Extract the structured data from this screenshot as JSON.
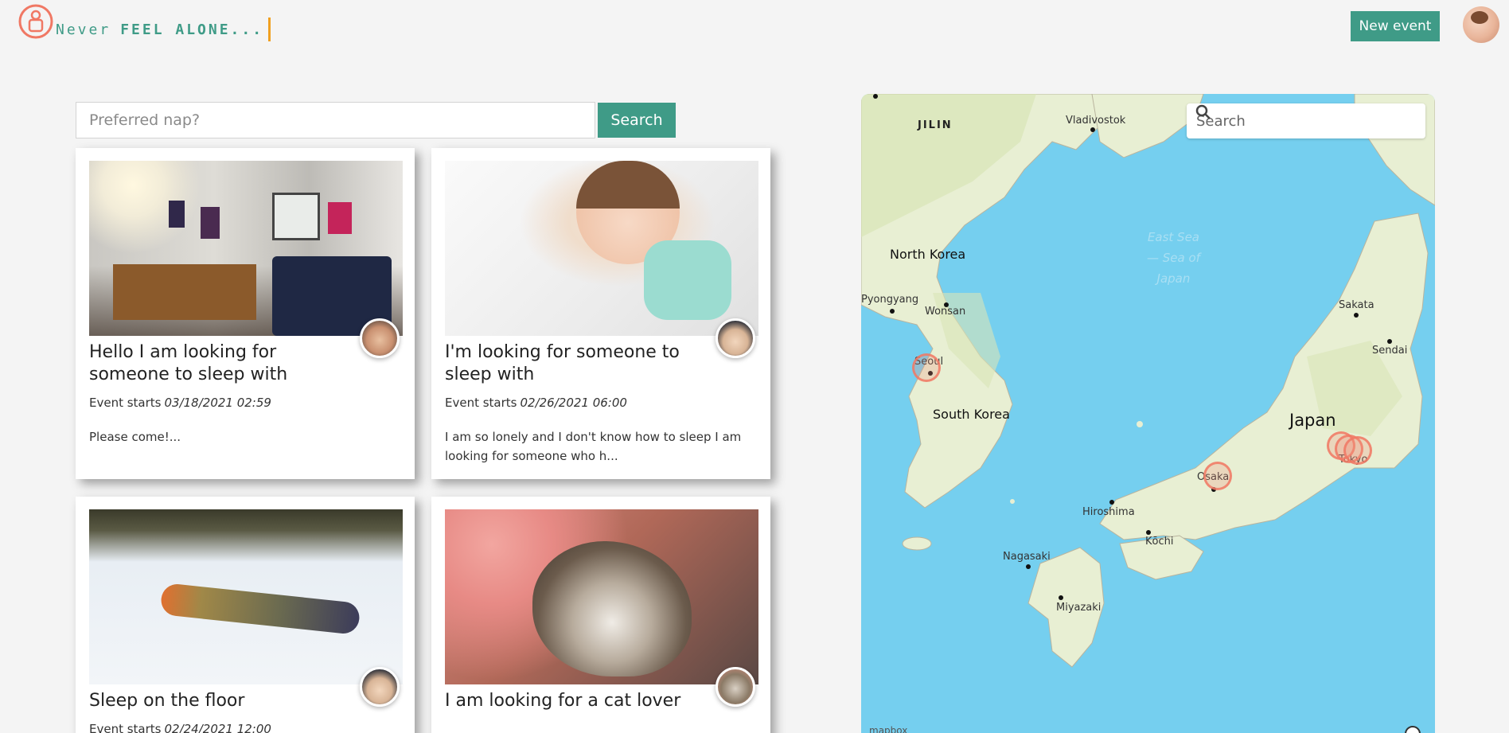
{
  "header": {
    "tagline_prefix": "Never",
    "tagline_strong": "FEEL ALONE...",
    "new_event_label": "New event"
  },
  "search": {
    "placeholder": "Preferred nap?",
    "button_label": "Search"
  },
  "cards": [
    {
      "title": "Hello I am looking for someone to sleep with",
      "starts_label": "Event starts",
      "starts_date": "03/18/2021 02:59",
      "description": "Please come!..."
    },
    {
      "title": "I'm looking for someone to sleep with",
      "starts_label": "Event starts",
      "starts_date": "02/26/2021 06:00",
      "description": "I am so lonely and I don't know how to sleep I am looking for someone who h..."
    },
    {
      "title": "Sleep on the floor",
      "starts_label": "Event starts",
      "starts_date": "02/24/2021 12:00",
      "description": ""
    },
    {
      "title": "I am looking for a cat lover",
      "starts_label": "",
      "starts_date": "",
      "description": ""
    }
  ],
  "map": {
    "search_placeholder": "Search",
    "labels": {
      "jilin": "JILIN",
      "vladivostok": "Vladivostok",
      "north_korea": "North Korea",
      "pyongyang": "Pyongyang",
      "wonsan": "Wonsan",
      "seoul": "Seoul",
      "south_korea": "South Korea",
      "sea": [
        "East Sea",
        "— Sea of",
        "Japan"
      ],
      "sakata": "Sakata",
      "sendai": "Sendai",
      "japan": "Japan",
      "osaka": "Osaka",
      "tokyo": "Tokyo",
      "hiroshima": "Hiroshima",
      "kochi": "Kōchi",
      "nagasaki": "Nagasaki",
      "miyazaki": "Miyazaki"
    },
    "attribution": "mapbox"
  },
  "colors": {
    "accent": "#3f9b87",
    "caret": "#f0a020",
    "marker": "#f07864",
    "water": "#75cfef",
    "land": "#e8efd3"
  }
}
